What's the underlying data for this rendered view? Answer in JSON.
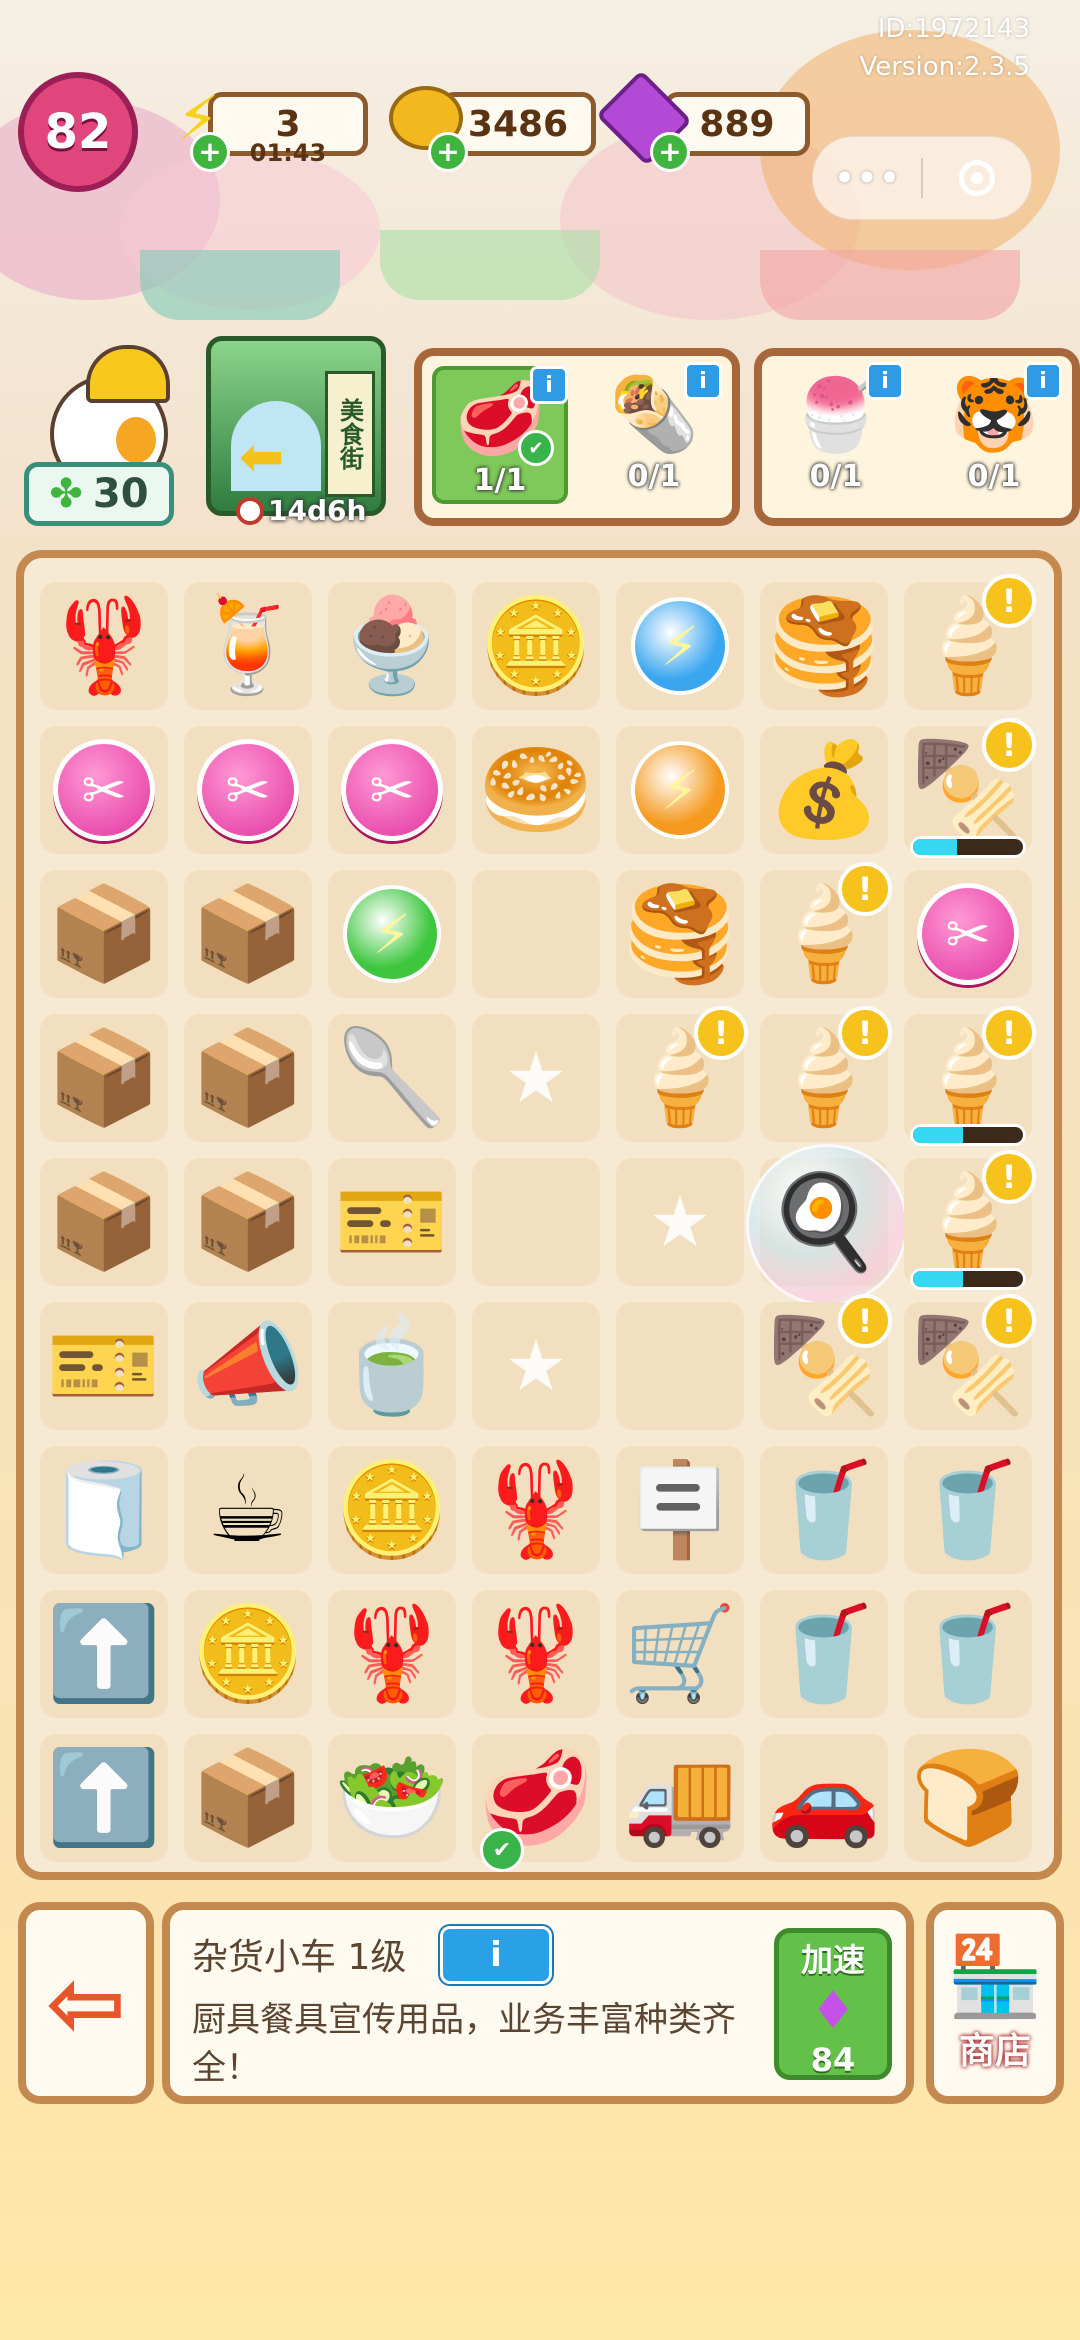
{
  "meta": {
    "id": "ID:1972143",
    "version": "Version:2.3.5"
  },
  "header": {
    "level": "82",
    "energy": {
      "value": "3",
      "timer": "01:43"
    },
    "coins": "3486",
    "gems": "889",
    "capsule": {
      "more_icon": "•••"
    }
  },
  "left": {
    "clover_count": "30",
    "street_timer": "14d6h",
    "street_sign": "美食街"
  },
  "orders": [
    {
      "group": 1,
      "icon": "🥩",
      "count": "1/1",
      "done": true
    },
    {
      "group": 1,
      "icon": "🌯",
      "count": "0/1",
      "done": false
    },
    {
      "group": 2,
      "icon": "🍧",
      "count": "0/1",
      "done": false
    },
    {
      "group": 2,
      "icon": "🐯",
      "count": "0/1",
      "done": false
    }
  ],
  "board": {
    "rows": [
      [
        {
          "t": "lobster"
        },
        {
          "t": "cocktail"
        },
        {
          "t": "sundae"
        },
        {
          "t": "coins"
        },
        {
          "t": "energy",
          "c": "blue"
        },
        {
          "t": "pancake"
        },
        {
          "t": "icecart",
          "badge": "!"
        }
      ],
      [
        {
          "t": "scissor"
        },
        {
          "t": "scissor"
        },
        {
          "t": "scissor"
        },
        {
          "t": "pancakes"
        },
        {
          "t": "energy",
          "c": "orange"
        },
        {
          "t": "coinpile"
        },
        {
          "t": "grill",
          "badge": "!",
          "progress": 40
        }
      ],
      [
        {
          "t": "box"
        },
        {
          "t": "box"
        },
        {
          "t": "energy",
          "c": "green"
        },
        {
          "t": "empty"
        },
        {
          "t": "pancake"
        },
        {
          "t": "icecart",
          "badge": "!"
        },
        {
          "t": "scissor"
        }
      ],
      [
        {
          "t": "box"
        },
        {
          "t": "box"
        },
        {
          "t": "ladle"
        },
        {
          "t": "star"
        },
        {
          "t": "icecart",
          "badge": "!"
        },
        {
          "t": "icecart",
          "badge": "!"
        },
        {
          "t": "icecart",
          "badge": "!",
          "progress": 45
        }
      ],
      [
        {
          "t": "box"
        },
        {
          "t": "box"
        },
        {
          "t": "seedbag"
        },
        {
          "t": "empty"
        },
        {
          "t": "star"
        },
        {
          "t": "pan",
          "bubble": true
        },
        {
          "t": "icecart",
          "badge": "!",
          "progress": 45
        }
      ],
      [
        {
          "t": "seedbag"
        },
        {
          "t": "megaphone"
        },
        {
          "t": "bowls"
        },
        {
          "t": "star"
        },
        {
          "t": "empty"
        },
        {
          "t": "grill",
          "badge": "!"
        },
        {
          "t": "grill",
          "badge": "!"
        }
      ],
      [
        {
          "t": "towel"
        },
        {
          "t": "mug"
        },
        {
          "t": "coins"
        },
        {
          "t": "lobster"
        },
        {
          "t": "sign"
        },
        {
          "t": "drink"
        },
        {
          "t": "drink"
        }
      ],
      [
        {
          "t": "arrowcard"
        },
        {
          "t": "coinstack"
        },
        {
          "t": "lobster"
        },
        {
          "t": "lobster"
        },
        {
          "t": "cart2"
        },
        {
          "t": "drink"
        },
        {
          "t": "drink"
        }
      ],
      [
        {
          "t": "arrowcard"
        },
        {
          "t": "parcel"
        },
        {
          "t": "plate"
        },
        {
          "t": "meat",
          "check": true
        },
        {
          "t": "truck"
        },
        {
          "t": "redcar"
        },
        {
          "t": "toaster"
        }
      ]
    ]
  },
  "icons": {
    "lobster": "🦞",
    "cocktail": "🍹",
    "sundae": "🍨",
    "coins": "🪙",
    "pancake": "🥞",
    "icecart": "🍦",
    "pancakes": "🥯",
    "coinpile": "💰",
    "grill": "🍢",
    "box": "📦",
    "ladle": "🥄",
    "seedbag": "🎫",
    "pan": "🍳",
    "megaphone": "📣",
    "bowls": "🍵",
    "towel": "🧻",
    "mug": "☕",
    "sign": "🪧",
    "drink": "🥤",
    "arrowcard": "⬆️",
    "coinstack": "🪙",
    "cart2": "🛒",
    "parcel": "📦",
    "plate": "🥗",
    "meat": "🥩",
    "truck": "🚚",
    "redcar": "🚗",
    "toaster": "🍞",
    "star": "★",
    "empty": "",
    "scissor": "✂",
    "energy": "⚡"
  },
  "bottom": {
    "exit_icon": "⇦",
    "item_title": "杂货小车 1级",
    "info_label": "i",
    "description": "厨具餐具宣传用品，业务丰富种类齐全！",
    "speedup_label": "加速",
    "speedup_cost": "84",
    "shop_label": "商店"
  },
  "colors": {
    "energy_blue": "#3aa6f0",
    "energy_orange": "#f59a1f",
    "energy_green": "#3ec73e",
    "accent_brown": "#a8673a"
  }
}
